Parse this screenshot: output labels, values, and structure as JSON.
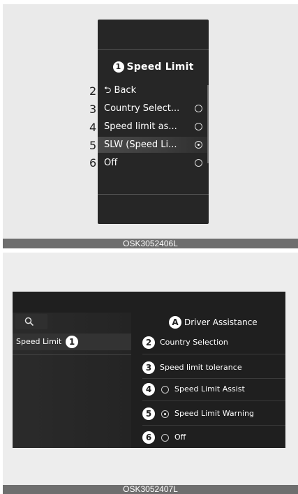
{
  "top": {
    "cluster": {
      "title_num": "1",
      "title": "Speed Limit",
      "items": [
        {
          "num": "2",
          "label": "⮌ Back",
          "radio": false,
          "selected": false
        },
        {
          "num": "3",
          "label": "Country Select...",
          "radio": true,
          "selected": false
        },
        {
          "num": "4",
          "label": "Speed limit as...",
          "radio": true,
          "selected": false
        },
        {
          "num": "5",
          "label": "SLW (Speed Li...",
          "radio": true,
          "selected": true
        },
        {
          "num": "6",
          "label": "Off",
          "radio": true,
          "selected": false
        }
      ]
    },
    "caption": "OSK3052406L"
  },
  "bottom": {
    "header_badge": "A",
    "header": "Driver Assistance",
    "sidebar_item": {
      "label": "Speed Limit",
      "num": "1"
    },
    "rows": [
      {
        "num": "2",
        "label": "Country Selection",
        "radio": false,
        "selected": false
      },
      {
        "num": "3",
        "label": "Speed limit tolerance",
        "radio": false,
        "selected": false
      },
      {
        "num": "4",
        "label": "Speed Limit Assist",
        "radio": true,
        "selected": false
      },
      {
        "num": "5",
        "label": "Speed Limit Warning",
        "radio": true,
        "selected": true
      },
      {
        "num": "6",
        "label": "Off",
        "radio": true,
        "selected": false
      }
    ],
    "caption": "OSK3052407L"
  },
  "icons": {
    "search": "search-icon",
    "back": "back-arrow-icon"
  },
  "colors": {
    "screen_bg": "#1f1f1f",
    "caption_bar": "#6e6e6e"
  }
}
